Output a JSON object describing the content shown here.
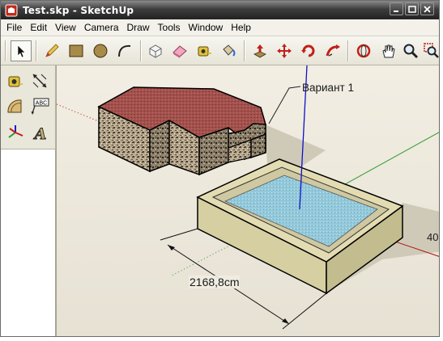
{
  "window": {
    "title": "Test.skp - SketchUp"
  },
  "menu": {
    "items": [
      "File",
      "Edit",
      "View",
      "Camera",
      "Draw",
      "Tools",
      "Window",
      "Help"
    ]
  },
  "toolbar": {
    "tools": [
      "select-icon",
      "pencil-icon",
      "rectangle-icon",
      "circle-icon",
      "arc-icon",
      "make-component-icon",
      "eraser-icon",
      "tape-measure-icon",
      "paint-bucket-icon",
      "push-pull-icon",
      "move-icon",
      "rotate-icon",
      "follow-me-icon",
      "orbit-icon",
      "pan-icon",
      "zoom-icon",
      "zoom-window-icon"
    ]
  },
  "side_tools": {
    "tools": [
      "tape-measure-icon",
      "dimensions-icon",
      "protractor-icon",
      "text-icon",
      "axes-icon",
      "3d-text-icon"
    ],
    "text_tool_label": "ABC",
    "text3d_label": "A"
  },
  "scene": {
    "label_variant": "Вариант 1",
    "dimension_text": "2168,8cm",
    "partial_dimension": "40",
    "colors": {
      "roof": "#a4524e",
      "stone": "#b8a890",
      "water": "#8fc6d8",
      "pool_rim": "#d9d3a6",
      "axis_blue": "#1010c8",
      "axis_red": "#b01010",
      "axis_green": "#2a9a2a"
    }
  }
}
